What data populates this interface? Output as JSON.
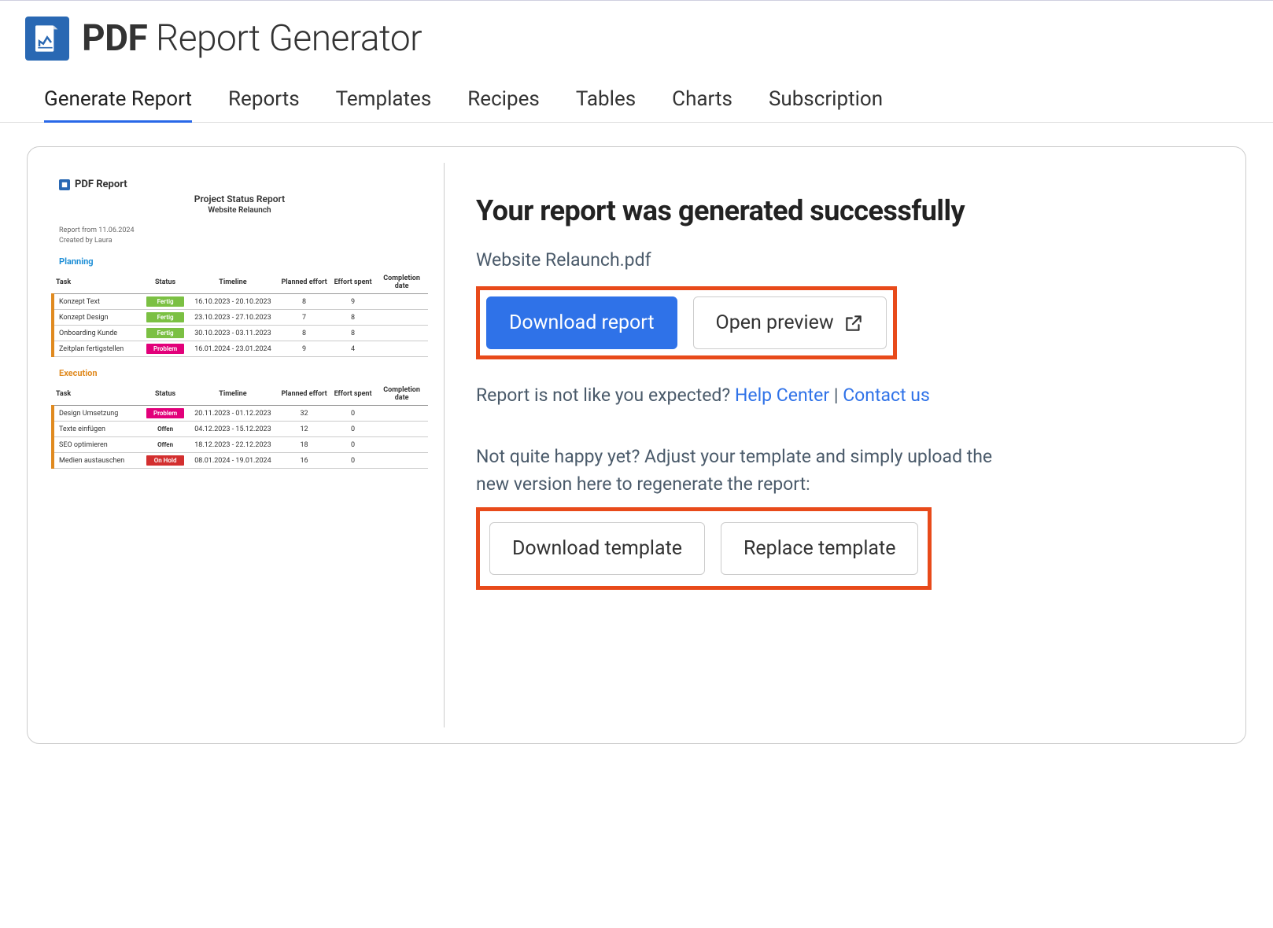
{
  "app": {
    "title_bold": "PDF",
    "title_rest": " Report Generator"
  },
  "tabs": {
    "items": [
      {
        "label": "Generate Report",
        "active": true
      },
      {
        "label": "Reports",
        "active": false
      },
      {
        "label": "Templates",
        "active": false
      },
      {
        "label": "Recipes",
        "active": false
      },
      {
        "label": "Tables",
        "active": false
      },
      {
        "label": "Charts",
        "active": false
      },
      {
        "label": "Subscription",
        "active": false
      }
    ]
  },
  "preview": {
    "head_label": "PDF Report",
    "title": "Project Status Report",
    "subtitle": "Website Relaunch",
    "meta_line1": "Report from 11.06.2024",
    "meta_line2": "Created by Laura",
    "sections": [
      {
        "name": "Planning",
        "class": "planning",
        "headers": [
          "Task",
          "Status",
          "Timeline",
          "Planned effort",
          "Effort spent",
          "Completion date"
        ],
        "rows": [
          {
            "task": "Konzept Text",
            "status": "Fertig",
            "status_class": "fertig",
            "timeline": "16.10.2023 - 20.10.2023",
            "planned": "8",
            "spent": "9",
            "completion": ""
          },
          {
            "task": "Konzept Design",
            "status": "Fertig",
            "status_class": "fertig",
            "timeline": "23.10.2023 - 27.10.2023",
            "planned": "7",
            "spent": "8",
            "completion": ""
          },
          {
            "task": "Onboarding Kunde",
            "status": "Fertig",
            "status_class": "fertig",
            "timeline": "30.10.2023 - 03.11.2023",
            "planned": "8",
            "spent": "8",
            "completion": ""
          },
          {
            "task": "Zeitplan fertigstellen",
            "status": "Problem",
            "status_class": "problem",
            "timeline": "16.01.2024 - 23.01.2024",
            "planned": "9",
            "spent": "4",
            "completion": ""
          }
        ]
      },
      {
        "name": "Execution",
        "class": "execution",
        "headers": [
          "Task",
          "Status",
          "Timeline",
          "Planned effort",
          "Effort spent",
          "Completion date"
        ],
        "rows": [
          {
            "task": "Design Umsetzung",
            "status": "Problem",
            "status_class": "problem",
            "timeline": "20.11.2023 - 01.12.2023",
            "planned": "32",
            "spent": "0",
            "completion": ""
          },
          {
            "task": "Texte einfügen",
            "status": "Offen",
            "status_class": "offen",
            "timeline": "04.12.2023 - 15.12.2023",
            "planned": "12",
            "spent": "0",
            "completion": ""
          },
          {
            "task": "SEO optimieren",
            "status": "Offen",
            "status_class": "offen",
            "timeline": "18.12.2023 - 22.12.2023",
            "planned": "18",
            "spent": "0",
            "completion": ""
          },
          {
            "task": "Medien austauschen",
            "status": "On Hold",
            "status_class": "onhold",
            "timeline": "08.01.2024 - 19.01.2024",
            "planned": "16",
            "spent": "0",
            "completion": ""
          }
        ]
      }
    ]
  },
  "result": {
    "heading": "Your report was generated successfully",
    "filename": "Website Relaunch.pdf",
    "download_btn": "Download report",
    "preview_btn": "Open preview",
    "help_prefix": "Report is not like you expected? ",
    "help_link": "Help Center",
    "help_sep": " | ",
    "contact_link": "Contact us",
    "adjust_text": "Not quite happy yet? Adjust your template and simply upload the new version here to regenerate the report:",
    "download_template_btn": "Download template",
    "replace_template_btn": "Replace template"
  }
}
